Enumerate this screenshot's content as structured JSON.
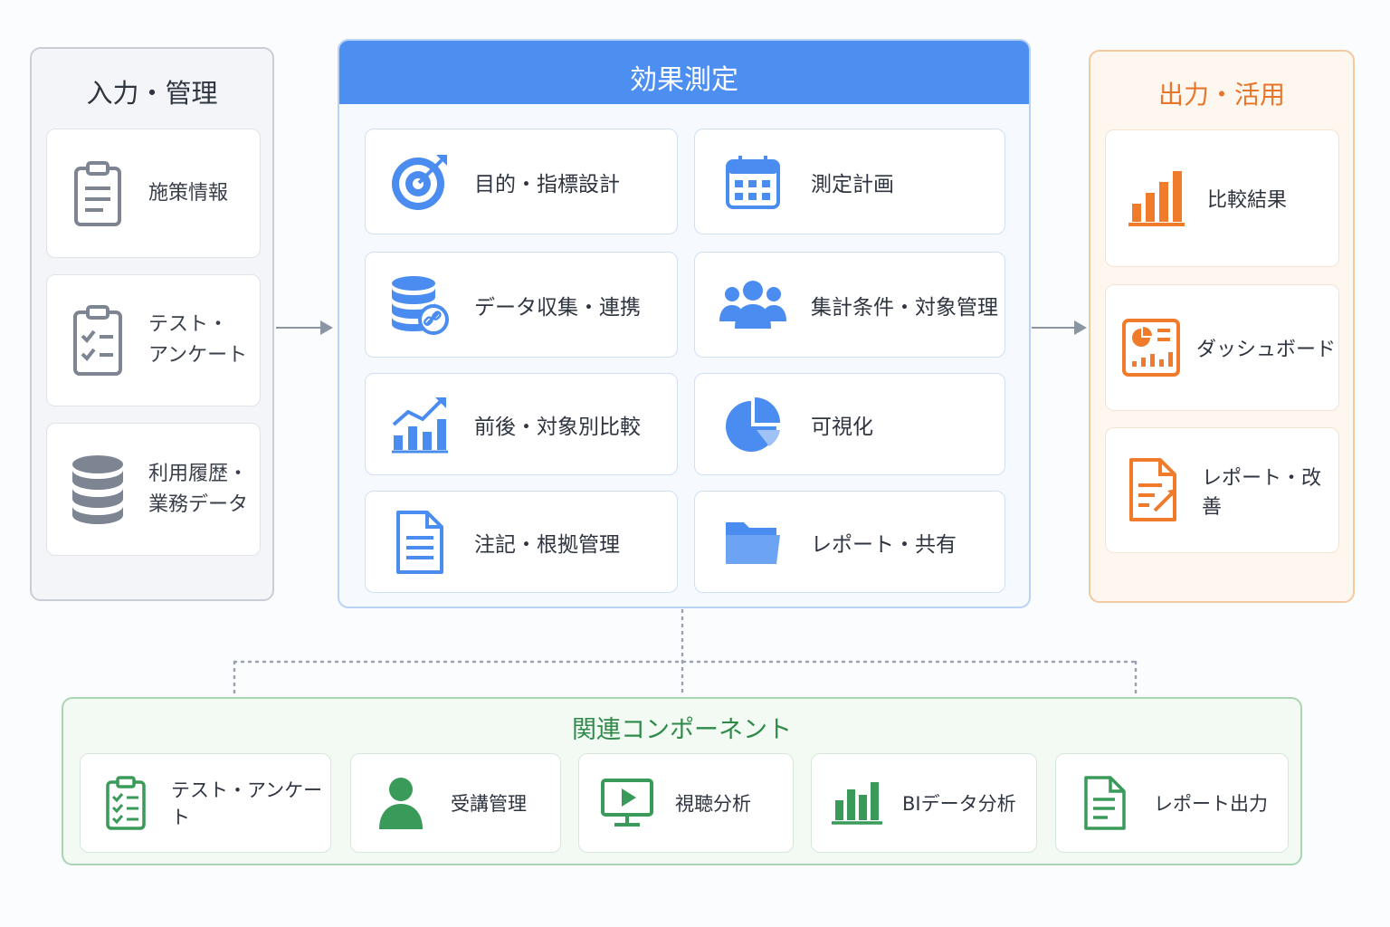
{
  "input_panel": {
    "title": "入力・管理",
    "items": [
      {
        "label_line1": "施策情報",
        "label_line2": "",
        "icon": "clipboard-icon"
      },
      {
        "label_line1": "テスト・",
        "label_line2": "アンケート",
        "icon": "checklist-icon"
      },
      {
        "label_line1": "利用履歴・",
        "label_line2": "業務データ",
        "icon": "database-icon"
      }
    ]
  },
  "measurement_panel": {
    "title": "効果測定",
    "items": [
      {
        "label": "目的・指標設計",
        "icon": "target-icon"
      },
      {
        "label": "測定計画",
        "icon": "calendar-icon"
      },
      {
        "label": "データ収集・連携",
        "icon": "database-link-icon"
      },
      {
        "label": "集計条件・対象管理",
        "icon": "users-icon"
      },
      {
        "label": "前後・対象別比較",
        "icon": "trend-chart-icon"
      },
      {
        "label": "可視化",
        "icon": "pie-chart-icon"
      },
      {
        "label": "注記・根拠管理",
        "icon": "document-icon"
      },
      {
        "label": "レポート・共有",
        "icon": "folder-icon"
      }
    ]
  },
  "output_panel": {
    "title": "出力・活用",
    "items": [
      {
        "label": "比較結果",
        "icon": "bar-chart-icon"
      },
      {
        "label": "ダッシュボード",
        "icon": "dashboard-icon"
      },
      {
        "label": "レポート・改善",
        "icon": "report-edit-icon"
      }
    ]
  },
  "related_panel": {
    "title": "関連コンポーネント",
    "items": [
      {
        "label": "テスト・アンケート",
        "icon": "checklist-icon"
      },
      {
        "label": "受講管理",
        "icon": "user-icon"
      },
      {
        "label": "視聴分析",
        "icon": "video-monitor-icon"
      },
      {
        "label": "BIデータ分析",
        "icon": "bar-chart-icon"
      },
      {
        "label": "レポート出力",
        "icon": "document-icon"
      }
    ]
  },
  "colors": {
    "input_accent": "#7d8593",
    "measurement_accent": "#4a8cef",
    "output_accent": "#f07c2b",
    "related_accent": "#3a9a59"
  }
}
